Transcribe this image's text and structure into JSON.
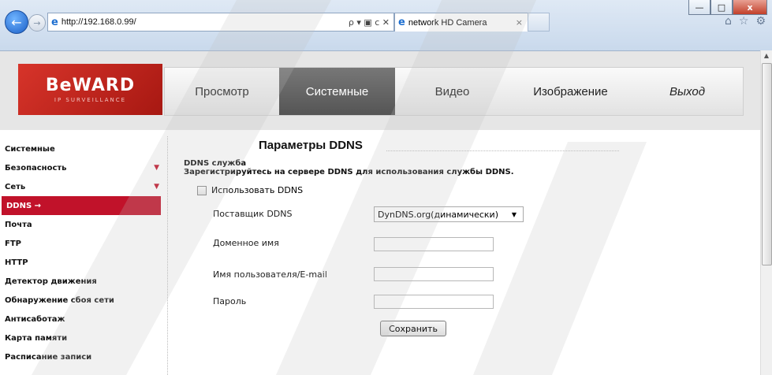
{
  "browser": {
    "address": "http://192.168.0.99/",
    "tab_title": "network HD Camera",
    "tab_close": "×",
    "address_controls": "ρ ▾ ▣ c ✕",
    "win_min": "—",
    "win_max": "□",
    "win_close": "x"
  },
  "logo": {
    "text": "BeWARD",
    "sub": "IP SURVEILLANCE"
  },
  "topnav": {
    "items": [
      {
        "label": "Просмотр"
      },
      {
        "label": "Системные"
      },
      {
        "label": "Видео"
      },
      {
        "label": "Изображение"
      },
      {
        "label": "Выход"
      }
    ]
  },
  "sidebar": {
    "items": [
      {
        "label": "Системные"
      },
      {
        "label": "Безопасность"
      },
      {
        "label": "Сеть"
      },
      {
        "label": "DDNS →"
      },
      {
        "label": "Почта"
      },
      {
        "label": "FTP"
      },
      {
        "label": "HTTP"
      },
      {
        "label": "Детектор движения"
      },
      {
        "label": "Обнаружение сбоя сети"
      },
      {
        "label": "Антисаботаж"
      },
      {
        "label": "Карта памяти"
      },
      {
        "label": "Расписание записи"
      }
    ]
  },
  "content": {
    "title": "Параметры DDNS",
    "service_heading": "DDNS служба",
    "service_desc": "Зарегистрируйтесь на сервере DDNS для использования службы DDNS.",
    "use_ddns_label": "Использовать DDNS",
    "provider_label": "Поставщик DDNS",
    "provider_value": "DynDNS.org(динамически)",
    "domain_label": "Доменное имя",
    "user_label": "Имя пользователя/E-mail",
    "password_label": "Пароль",
    "save_label": "Сохранить"
  },
  "colors": {
    "accent": "#c1122a",
    "active_tab": "#666666"
  }
}
